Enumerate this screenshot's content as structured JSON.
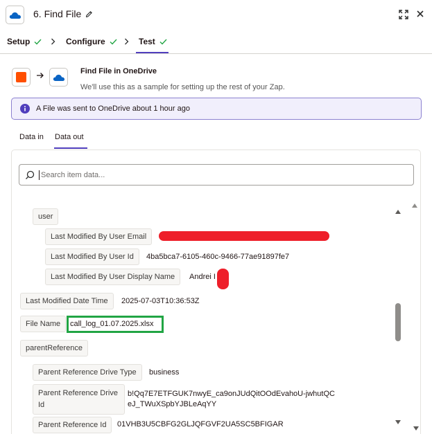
{
  "header": {
    "title": "6. Find File",
    "app_icon": "onedrive-cloud-icon",
    "colors": {
      "onedrive_blue": "#0a64c4",
      "accent": "#503ebd",
      "check": "#21a544"
    }
  },
  "steps": [
    {
      "label": "Setup",
      "done": true
    },
    {
      "label": "Configure",
      "done": true
    },
    {
      "label": "Test",
      "done": true,
      "active": true
    }
  ],
  "info": {
    "title": "Find File in OneDrive",
    "subtitle": "We'll use this as a sample for setting up the rest of your Zap.",
    "banner": "A File was sent to OneDrive about 1 hour ago"
  },
  "data_tabs": {
    "data_in": "Data in",
    "data_out": "Data out"
  },
  "search": {
    "placeholder": "Search item data..."
  },
  "tree": {
    "user_group": "user",
    "email_key": "Last Modified By User Email",
    "email_value": "",
    "userid_key": "Last Modified By User Id",
    "userid_value": "4ba5bca7-6105-460c-9466-77ae91897fe7",
    "display_key": "Last Modified By User Display Name",
    "display_value": "Andrei I",
    "modified_key": "Last Modified Date Time",
    "modified_value": "2025-07-03T10:36:53Z",
    "filename_key": "File Name",
    "filename_value": "call_log_01.07.2025.xlsx",
    "parent_group": "parentReference",
    "drive_type_key": "Parent Reference Drive Type",
    "drive_type_value": "business",
    "drive_id_key": "Parent Reference Drive Id",
    "drive_id_value": "b!Qq7E7ETFGUK7nwyE_ca9onJUdQitOOdEvahoU-jwhutQCeJ_TWuXSpbYJBLeAqYY",
    "parent_id_key": "Parent Reference Id",
    "parent_id_value": "01VHB3U5CBFG2GLJQFGVF2UA5SC5BFIGAR"
  }
}
